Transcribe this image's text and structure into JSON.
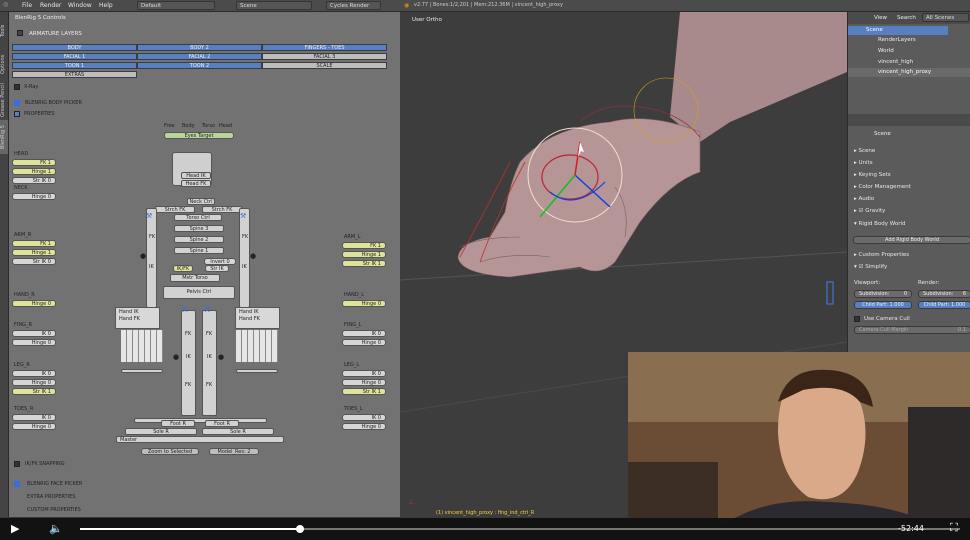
{
  "topbar": {
    "menus": [
      "File",
      "Render",
      "Window",
      "Help"
    ],
    "layout": "Default",
    "scene": "Scene",
    "engine": "Cycles Render",
    "stats": "v2.77 | Bones:1/2,201 | Mem:212.36M | vincent_high_proxy"
  },
  "sidetabs": [
    "Tools",
    "Options",
    "Grease Pencil",
    "BlenRig 5"
  ],
  "panel": {
    "title": "BlenRig 5 Controls",
    "armature_layers": "ARMATURE LAYERS",
    "layers": [
      [
        "BODY",
        "BODY 2",
        "FINGERS - TOES"
      ],
      [
        "FACIAL 1",
        "FACIAL 2",
        "FACIAL 3"
      ],
      [
        "TOON 1",
        "TOON 2",
        "SCALE"
      ],
      [
        "EXTRAS"
      ]
    ],
    "xray": "X-Ray",
    "body_picker": "BLENRIG BODY PICKER",
    "properties": "PROPERTIES",
    "modes": [
      "Free",
      "Body",
      "Torso",
      "Head"
    ],
    "eyes_target": "Eyes Target",
    "left_col": [
      {
        "h": "HEAD",
        "items": [
          "FK 1",
          "Hinge 1",
          "Str IK 0"
        ]
      },
      {
        "h": "NECK",
        "items": [
          "Hinge 0"
        ]
      },
      {
        "h": "ARM_R",
        "items": [
          "FK 1",
          "Hinge 1",
          "Str IK 0"
        ]
      },
      {
        "h": "HAND_R",
        "items": [
          "Hinge 0"
        ]
      },
      {
        "h": "FING_R",
        "items": [
          "IK 0",
          "Hinge 0"
        ]
      },
      {
        "h": "LEG_R",
        "items": [
          "IK 0",
          "Hinge 0",
          "Str IK 1"
        ]
      },
      {
        "h": "TOES_R",
        "items": [
          "IK 0",
          "Hinge 0"
        ]
      }
    ],
    "right_col": [
      {
        "h": "ARM_L",
        "items": [
          "FK 1",
          "Hinge 1",
          "Str IK 1"
        ]
      },
      {
        "h": "HAND_L",
        "items": [
          "Hinge 0"
        ]
      },
      {
        "h": "FING_L",
        "items": [
          "IK 0",
          "Hinge 0"
        ]
      },
      {
        "h": "LEG_L",
        "items": [
          "IK 0",
          "Hinge 0",
          "Str IK 1"
        ]
      },
      {
        "h": "TOES_L",
        "items": [
          "IK 0",
          "Hinge 0"
        ]
      }
    ],
    "body": {
      "head_ik": "Head IK",
      "head_fk": "Head FK",
      "neck_ctrl": "Neck Ctrl",
      "strch_fk_r": "Strch FK",
      "strch_fk_l": "Strch FK",
      "torso_ctrl": "Torso Ctrl",
      "spine3": "Spine 3",
      "spine2": "Spine 2",
      "spine1": "Spine 1",
      "mstr_torso": "Mstr Torso",
      "pelvis": "Pelvis Ctrl",
      "ikfk": "IK/FK",
      "strik": "Str IK",
      "invert": "Invert 0",
      "hand_ik_r": "Hand IK",
      "hand_fk_r": "Hand FK",
      "hand_ik_l": "Hand IK",
      "hand_fk_l": "Hand FK",
      "fk": "FK",
      "ik": "IK",
      "foot_r": "Foot R",
      "foot_l": "Foot R",
      "sole_r": "Sole R",
      "sole_l": "Sole R",
      "master": "Master"
    },
    "zoom": "Zoom to Selected",
    "model_res": "Model_Res: 2",
    "ikfk_snapping": "IK/FK SNAPPING",
    "face_picker": "BLENRIG FACE PICKER",
    "extra_props": "EXTRA PROPERTIES",
    "custom_props": "CUSTOM PROPERTIES"
  },
  "viewport": {
    "label": "User Ortho",
    "status": "(1) vincent_high_proxy : fing_ind_ctrl_R"
  },
  "outliner": {
    "tabs": [
      "View",
      "Search",
      "All Scenes"
    ],
    "items": [
      "Scene",
      "RenderLayers",
      "World",
      "vincent_high",
      "vincent_high_proxy"
    ]
  },
  "properties": {
    "context": "Scene",
    "sections": [
      "Scene",
      "Units",
      "Keying Sets",
      "Color Management",
      "Audio",
      "Gravity",
      "Rigid Body World"
    ],
    "add_rbw": "Add Rigid Body World",
    "custom_props": "Custom Properties",
    "simplify": "Simplify",
    "viewport": "Viewport:",
    "render": "Render:",
    "subdiv_v": "Subdivision:",
    "subdiv_v_val": "0",
    "subdiv_r": "Subdivision:",
    "subdiv_r_val": "6",
    "child_v": "Child Part: 1.000",
    "child_r": "Child Part: 1.000",
    "camera_cull": "Use Camera Cull",
    "cull_margin": "Camera Cull Margin",
    "cull_val": "0.1"
  },
  "player": {
    "time": "-52:44",
    "progress": 0.25
  }
}
